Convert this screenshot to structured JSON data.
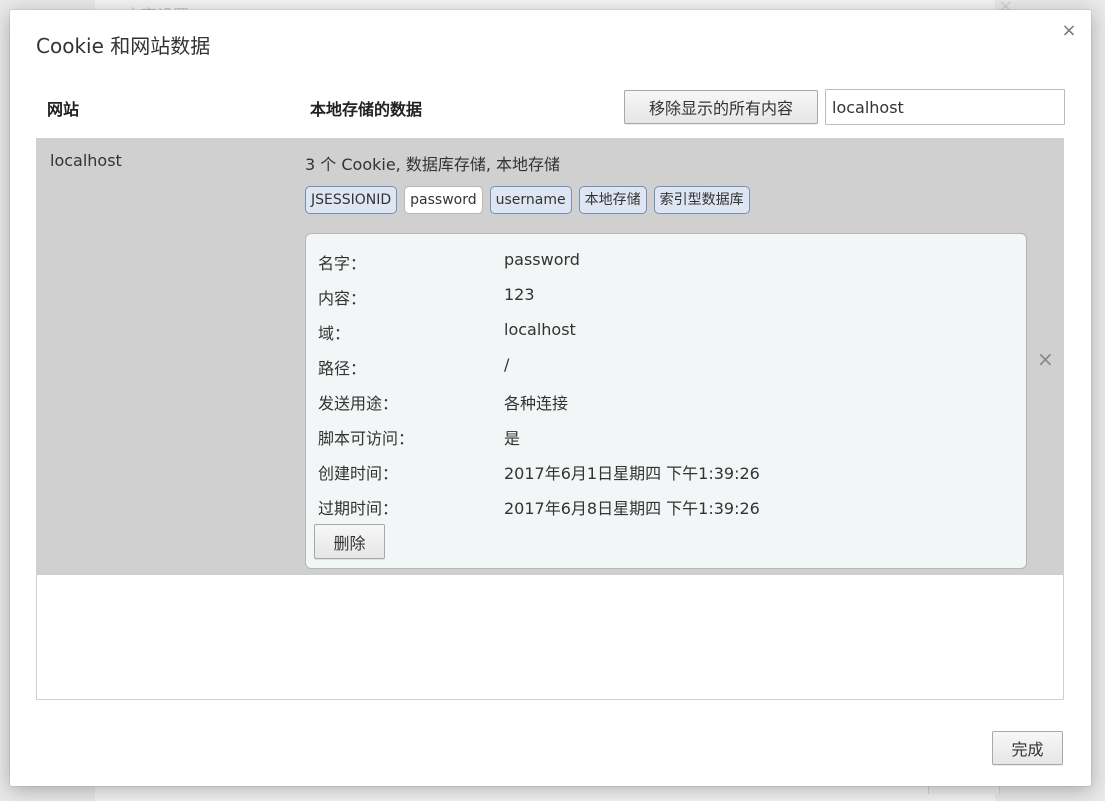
{
  "background": {
    "title": "内容设置"
  },
  "dialog": {
    "title": "Cookie 和网站数据",
    "columns": {
      "site": "网站",
      "data": "本地存储的数据"
    },
    "remove_all_label": "移除显示的所有内容",
    "search_value": "localhost",
    "site": {
      "name": "localhost",
      "summary": "3 个 Cookie, 数据库存储, 本地存储",
      "chips": [
        "JSESSIONID",
        "password",
        "username",
        "本地存储",
        "索引型数据库"
      ],
      "selected_chip": "password",
      "details": [
        {
          "label": "名字：",
          "value": "password"
        },
        {
          "label": "内容：",
          "value": "123"
        },
        {
          "label": "域：",
          "value": "localhost"
        },
        {
          "label": "路径：",
          "value": "/"
        },
        {
          "label": "发送用途：",
          "value": "各种连接"
        },
        {
          "label": "脚本可访问：",
          "value": "是"
        },
        {
          "label": "创建时间：",
          "value": "2017年6月1日星期四 下午1:39:26"
        },
        {
          "label": "过期时间：",
          "value": "2017年6月8日星期四 下午1:39:26"
        }
      ],
      "delete_label": "删除"
    },
    "done_label": "完成"
  },
  "icons": {
    "close": "×"
  },
  "colors": {
    "selected_row": "#d0d0d0",
    "chip_bg": "#dfe6f3",
    "chip_border": "#7a8fb8",
    "panel_bg": "#f3f6f6"
  }
}
